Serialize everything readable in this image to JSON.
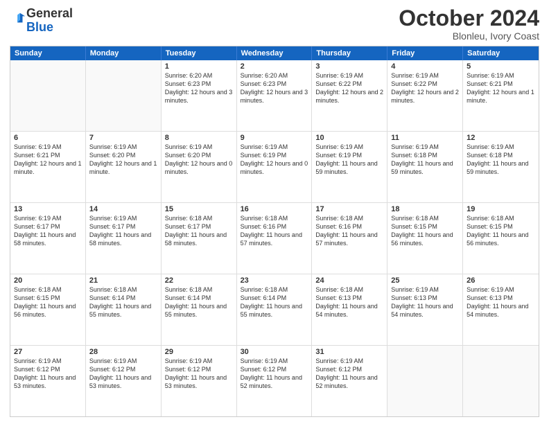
{
  "logo": {
    "general": "General",
    "blue": "Blue"
  },
  "header": {
    "month": "October 2024",
    "location": "Blonleu, Ivory Coast"
  },
  "days": [
    "Sunday",
    "Monday",
    "Tuesday",
    "Wednesday",
    "Thursday",
    "Friday",
    "Saturday"
  ],
  "weeks": [
    [
      {
        "day": "",
        "empty": true
      },
      {
        "day": "",
        "empty": true
      },
      {
        "day": "1",
        "sunrise": "6:20 AM",
        "sunset": "6:23 PM",
        "daylight": "12 hours and 3 minutes."
      },
      {
        "day": "2",
        "sunrise": "6:20 AM",
        "sunset": "6:23 PM",
        "daylight": "12 hours and 3 minutes."
      },
      {
        "day": "3",
        "sunrise": "6:19 AM",
        "sunset": "6:22 PM",
        "daylight": "12 hours and 2 minutes."
      },
      {
        "day": "4",
        "sunrise": "6:19 AM",
        "sunset": "6:22 PM",
        "daylight": "12 hours and 2 minutes."
      },
      {
        "day": "5",
        "sunrise": "6:19 AM",
        "sunset": "6:21 PM",
        "daylight": "12 hours and 1 minute."
      }
    ],
    [
      {
        "day": "6",
        "sunrise": "6:19 AM",
        "sunset": "6:21 PM",
        "daylight": "12 hours and 1 minute."
      },
      {
        "day": "7",
        "sunrise": "6:19 AM",
        "sunset": "6:20 PM",
        "daylight": "12 hours and 1 minute."
      },
      {
        "day": "8",
        "sunrise": "6:19 AM",
        "sunset": "6:20 PM",
        "daylight": "12 hours and 0 minutes."
      },
      {
        "day": "9",
        "sunrise": "6:19 AM",
        "sunset": "6:19 PM",
        "daylight": "12 hours and 0 minutes."
      },
      {
        "day": "10",
        "sunrise": "6:19 AM",
        "sunset": "6:19 PM",
        "daylight": "11 hours and 59 minutes."
      },
      {
        "day": "11",
        "sunrise": "6:19 AM",
        "sunset": "6:18 PM",
        "daylight": "11 hours and 59 minutes."
      },
      {
        "day": "12",
        "sunrise": "6:19 AM",
        "sunset": "6:18 PM",
        "daylight": "11 hours and 59 minutes."
      }
    ],
    [
      {
        "day": "13",
        "sunrise": "6:19 AM",
        "sunset": "6:17 PM",
        "daylight": "11 hours and 58 minutes."
      },
      {
        "day": "14",
        "sunrise": "6:19 AM",
        "sunset": "6:17 PM",
        "daylight": "11 hours and 58 minutes."
      },
      {
        "day": "15",
        "sunrise": "6:18 AM",
        "sunset": "6:17 PM",
        "daylight": "11 hours and 58 minutes."
      },
      {
        "day": "16",
        "sunrise": "6:18 AM",
        "sunset": "6:16 PM",
        "daylight": "11 hours and 57 minutes."
      },
      {
        "day": "17",
        "sunrise": "6:18 AM",
        "sunset": "6:16 PM",
        "daylight": "11 hours and 57 minutes."
      },
      {
        "day": "18",
        "sunrise": "6:18 AM",
        "sunset": "6:15 PM",
        "daylight": "11 hours and 56 minutes."
      },
      {
        "day": "19",
        "sunrise": "6:18 AM",
        "sunset": "6:15 PM",
        "daylight": "11 hours and 56 minutes."
      }
    ],
    [
      {
        "day": "20",
        "sunrise": "6:18 AM",
        "sunset": "6:15 PM",
        "daylight": "11 hours and 56 minutes."
      },
      {
        "day": "21",
        "sunrise": "6:18 AM",
        "sunset": "6:14 PM",
        "daylight": "11 hours and 55 minutes."
      },
      {
        "day": "22",
        "sunrise": "6:18 AM",
        "sunset": "6:14 PM",
        "daylight": "11 hours and 55 minutes."
      },
      {
        "day": "23",
        "sunrise": "6:18 AM",
        "sunset": "6:14 PM",
        "daylight": "11 hours and 55 minutes."
      },
      {
        "day": "24",
        "sunrise": "6:18 AM",
        "sunset": "6:13 PM",
        "daylight": "11 hours and 54 minutes."
      },
      {
        "day": "25",
        "sunrise": "6:19 AM",
        "sunset": "6:13 PM",
        "daylight": "11 hours and 54 minutes."
      },
      {
        "day": "26",
        "sunrise": "6:19 AM",
        "sunset": "6:13 PM",
        "daylight": "11 hours and 54 minutes."
      }
    ],
    [
      {
        "day": "27",
        "sunrise": "6:19 AM",
        "sunset": "6:12 PM",
        "daylight": "11 hours and 53 minutes."
      },
      {
        "day": "28",
        "sunrise": "6:19 AM",
        "sunset": "6:12 PM",
        "daylight": "11 hours and 53 minutes."
      },
      {
        "day": "29",
        "sunrise": "6:19 AM",
        "sunset": "6:12 PM",
        "daylight": "11 hours and 53 minutes."
      },
      {
        "day": "30",
        "sunrise": "6:19 AM",
        "sunset": "6:12 PM",
        "daylight": "11 hours and 52 minutes."
      },
      {
        "day": "31",
        "sunrise": "6:19 AM",
        "sunset": "6:12 PM",
        "daylight": "11 hours and 52 minutes."
      },
      {
        "day": "",
        "empty": true
      },
      {
        "day": "",
        "empty": true
      }
    ]
  ]
}
